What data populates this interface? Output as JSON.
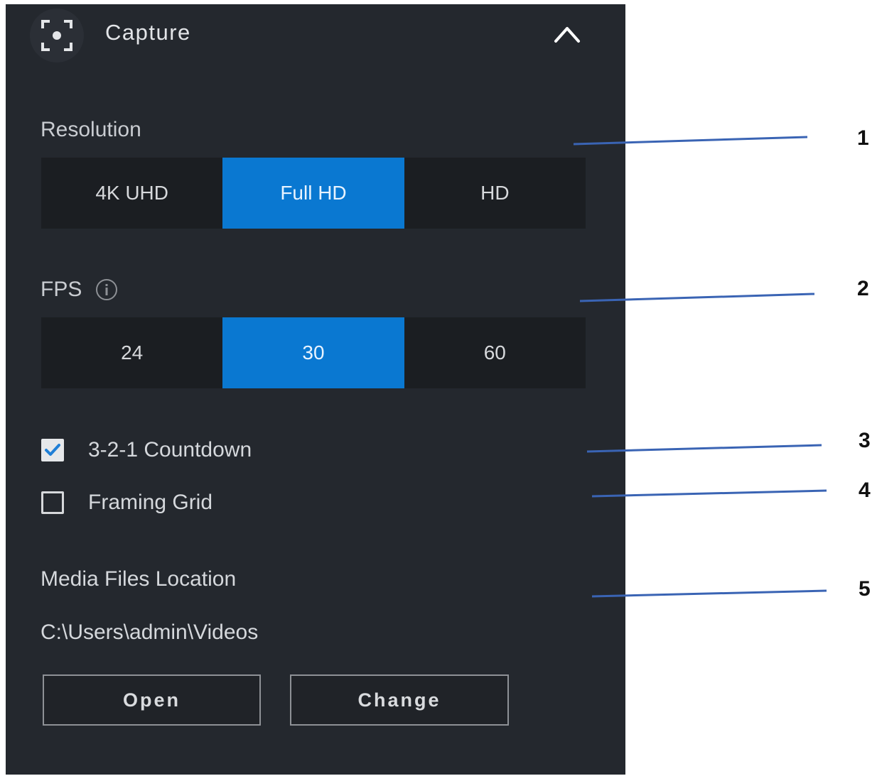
{
  "header": {
    "title": "Capture",
    "icon": "capture-focus-icon",
    "collapse_icon": "chevron-up-icon"
  },
  "resolution": {
    "label": "Resolution",
    "options": [
      "4K UHD",
      "Full HD",
      "HD"
    ],
    "selected": "Full HD"
  },
  "fps": {
    "label": "FPS",
    "info_icon": "info-icon",
    "options": [
      "24",
      "30",
      "60"
    ],
    "selected": "30"
  },
  "countdown": {
    "label": "3-2-1 Countdown",
    "checked": true
  },
  "framing_grid": {
    "label": "Framing Grid",
    "checked": false
  },
  "media": {
    "label": "Media Files Location",
    "path": "C:\\Users\\admin\\Videos",
    "open_label": "Open",
    "change_label": "Change"
  },
  "callouts": [
    "1",
    "2",
    "3",
    "4",
    "5"
  ],
  "colors": {
    "panel_bg": "#24282e",
    "accent": "#0a78d1",
    "callout_line": "#3a64b4"
  }
}
